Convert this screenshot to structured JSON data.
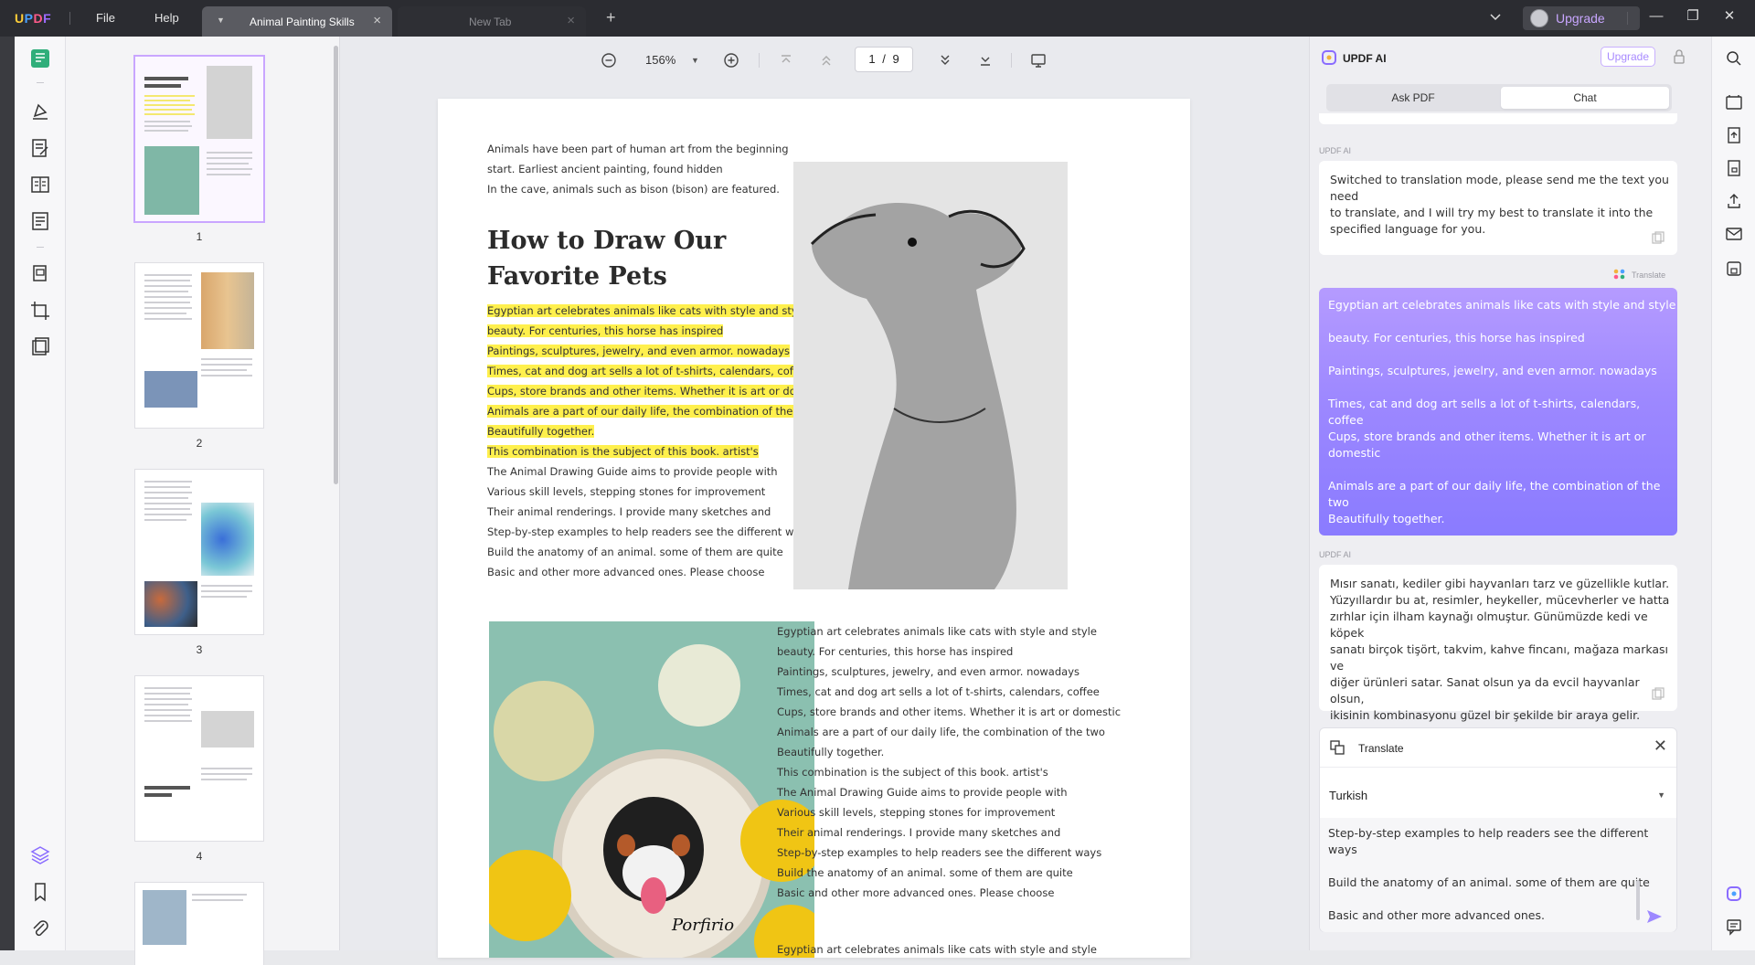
{
  "app": {
    "logo": "UPDF",
    "menu": [
      "File",
      "Help"
    ],
    "tabs": [
      {
        "label": "Animal Painting Skills",
        "active": true
      },
      {
        "label": "New Tab",
        "active": false
      }
    ],
    "upgrade_label": "Upgrade",
    "window_controls": [
      "minimize-icon",
      "restore-icon",
      "close-icon"
    ]
  },
  "left_toolbar": {
    "icons": [
      "reader-icon",
      "comment-icon",
      "edit-pdf-icon",
      "page-organize-icon",
      "form-icon",
      "ocr-icon",
      "crop-icon",
      "protect-icon",
      "layers-icon",
      "bookmark-icon",
      "attachment-icon"
    ]
  },
  "thumbnails": {
    "pages": [
      "1",
      "2",
      "3",
      "4"
    ],
    "selected": "1"
  },
  "doc_toolbar": {
    "zoom": "156%",
    "page_current": "1",
    "page_separator": "/",
    "page_total": "9"
  },
  "page": {
    "intro": [
      "Animals have been part of human art from the beginning",
      "start. Earliest ancient painting, found hidden",
      "In the cave, animals such as bison (bison) are featured."
    ],
    "heading": [
      "How to Draw Our",
      "Favorite Pets"
    ],
    "highlighted": [
      "Egyptian art celebrates animals like cats with style and style",
      "beauty. For centuries, this horse has inspired",
      "Paintings, sculptures, jewelry, and even armor. nowadays",
      "Times, cat and dog art sells a lot of t-shirts, calendars, coffee",
      "Cups, store brands and other items. Whether it is art or domestic",
      "Animals are a part of our daily life, the combination of the two",
      "Beautifully together.",
      "This combination is the subject of this book. artist's"
    ],
    "body": [
      "The Animal Drawing Guide aims to provide people with",
      "Various skill levels, stepping stones for improvement",
      "Their animal renderings. I provide many sketches and",
      "Step-by-step examples to help readers see the different ways",
      "Build the anatomy of an animal. some of them are quite",
      "Basic and other more advanced ones. Please choose"
    ],
    "right_column": [
      "Egyptian art celebrates animals like cats with style and style",
      "beauty. For centuries, this horse has inspired",
      "Paintings, sculptures, jewelry, and even armor. nowadays",
      "Times, cat and dog art sells a lot of t-shirts, calendars, coffee",
      "Cups, store brands and other items. Whether it is art or domestic",
      "Animals are a part of our daily life, the combination of the two",
      "Beautifully together.",
      "This combination is the subject of this book. artist's",
      "The Animal Drawing Guide aims to provide people with",
      "Various skill levels, stepping stones for improvement",
      "Their animal renderings. I provide many sketches and",
      "Step-by-step examples to help readers see the different ways",
      "Build the anatomy of an animal. some of them are quite",
      "Basic and other more advanced ones. Please choose"
    ],
    "right_column_tail": "Egyptian art celebrates animals like cats with style and style",
    "flowers_signature": "Porfirio"
  },
  "ai": {
    "title": "UPDF AI",
    "upgrade_label": "Upgrade",
    "tabs": [
      "Ask PDF",
      "Chat"
    ],
    "active_tab": "Chat",
    "label": "UPDF AI",
    "msg1": [
      "Switched to translation mode, please send me the text you need",
      "to translate, and I will try my best to translate it into the",
      "specified language for you."
    ],
    "translate_tag": "Translate",
    "user_msg": [
      "Egyptian art celebrates animals like cats with style and style",
      "beauty. For centuries, this horse has inspired",
      "Paintings, sculptures, jewelry, and even armor. nowadays",
      "Times, cat and dog art sells a lot of t-shirts, calendars, coffee",
      "Cups, store brands and other items. Whether it is art or",
      "domestic",
      "Animals are a part of our daily life, the combination of the two",
      "Beautifully together."
    ],
    "msg2": [
      "Mısır sanatı, kediler gibi hayvanları tarz ve güzellikle kutlar.",
      "Yüzyıllardır bu at, resimler, heykeller, mücevherler ve hatta",
      "zırhlar için ilham kaynağı olmuştur. Günümüzde kedi ve köpek",
      "sanatı birçok tişört, takvim, kahve fincanı, mağaza markası ve",
      "diğer ürünleri satar. Sanat olsun ya da evcil hayvanlar olsun,",
      "ikisinin kombinasyonu güzel bir şekilde bir araya gelir."
    ],
    "translate_panel": {
      "title": "Translate",
      "language": "Turkish",
      "input": [
        "Step-by-step examples to help readers see the different",
        "ways",
        "Build the anatomy of an animal. some of them are quite",
        "Basic and other more advanced ones."
      ]
    }
  },
  "colors": {
    "accent": "#9d88ff",
    "highlight": "#fff04d",
    "titlebar": "#2b2c31"
  }
}
